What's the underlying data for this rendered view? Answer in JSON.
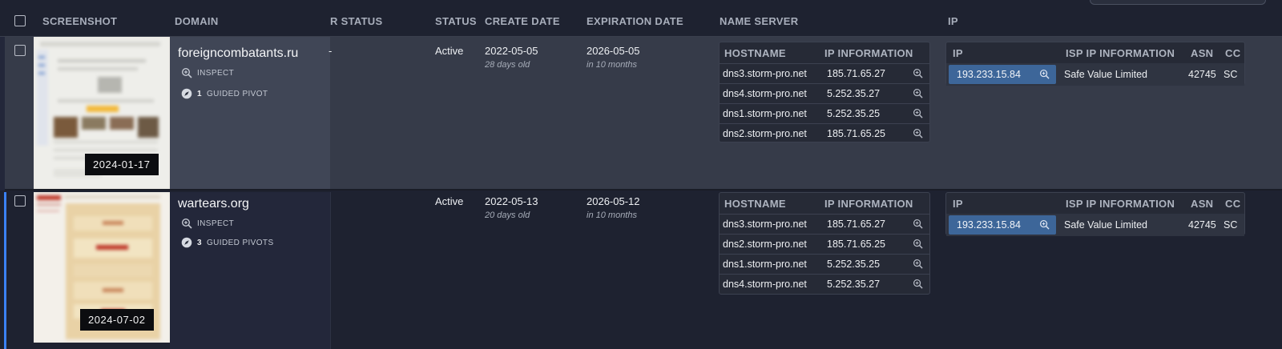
{
  "header": {
    "screenshot": "SCREENSHOT",
    "domain": "DOMAIN",
    "registrar_status": "R STATUS",
    "status": "STATUS",
    "create_date": "CREATE DATE",
    "expiration_date": "EXPIRATION DATE",
    "name_server": "NAME SERVER",
    "ip": "IP"
  },
  "subtable_headers": {
    "hostname": "HOSTNAME",
    "ip_information": "IP INFORMATION",
    "ip": "IP",
    "isp_ip_information": "ISP IP INFORMATION",
    "asn": "ASN",
    "cc": "CC"
  },
  "rows": [
    {
      "screenshot_date": "2024-01-17",
      "domain": "foreigncombatants.ru",
      "inspect_label": "INSPECT",
      "pivot_count": "1",
      "pivot_label": "GUIDED PIVOT",
      "registrar_status": "-",
      "status": "Active",
      "create_date": "2022-05-05",
      "create_age": "28 days old",
      "expiration_date": "2026-05-05",
      "expiration_rel": "in 10 months",
      "name_servers": [
        {
          "host": "dns3.storm-pro.net",
          "ip": "185.71.65.27"
        },
        {
          "host": "dns4.storm-pro.net",
          "ip": "5.252.35.27"
        },
        {
          "host": "dns1.storm-pro.net",
          "ip": "5.252.35.25"
        },
        {
          "host": "dns2.storm-pro.net",
          "ip": "185.71.65.25"
        }
      ],
      "ip": {
        "address": "193.233.15.84",
        "isp": "Safe Value Limited",
        "asn": "42745",
        "cc": "SC"
      }
    },
    {
      "screenshot_date": "2024-07-02",
      "domain": "wartears.org",
      "inspect_label": "INSPECT",
      "pivot_count": "3",
      "pivot_label": "GUIDED PIVOTS",
      "registrar_status": "",
      "status": "Active",
      "create_date": "2022-05-13",
      "create_age": "20 days old",
      "expiration_date": "2026-05-12",
      "expiration_rel": "in 10 months",
      "name_servers": [
        {
          "host": "dns3.storm-pro.net",
          "ip": "185.71.65.27"
        },
        {
          "host": "dns2.storm-pro.net",
          "ip": "185.71.65.25"
        },
        {
          "host": "dns1.storm-pro.net",
          "ip": "5.252.35.25"
        },
        {
          "host": "dns4.storm-pro.net",
          "ip": "5.252.35.27"
        }
      ],
      "ip": {
        "address": "193.233.15.84",
        "isp": "Safe Value Limited",
        "asn": "42745",
        "cc": "SC"
      }
    }
  ],
  "colors": {
    "row_selected_bg": "#363b49",
    "row_bg": "#1e2230",
    "accent_blue": "#3b82f6",
    "ip_chip": "#3d6699"
  },
  "icons": [
    "zoom-in-icon",
    "compass-icon",
    "checkbox-icon"
  ]
}
